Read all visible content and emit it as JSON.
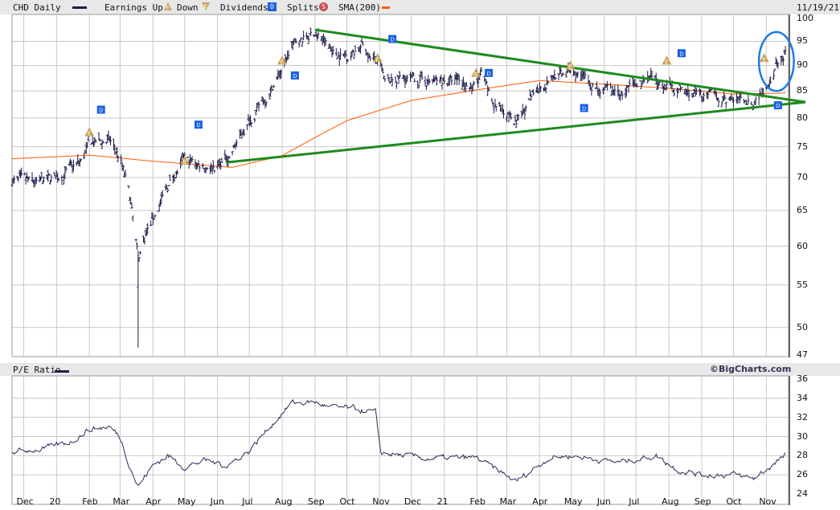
{
  "header": {
    "symbol_label": "CHD Daily",
    "earnings_label": "Earnings Up",
    "down_label": "Down",
    "dividends_label": "Dividends",
    "splits_label": "Splits",
    "sma_label": "SMA(200)",
    "date": "11/19/21",
    "earnings_up_glyph": "E",
    "earnings_down_glyph": "E",
    "dividend_glyph": "D",
    "split_glyph": "S"
  },
  "lower_header": {
    "label": "P/E Ratio",
    "brand": "©BigCharts.com"
  },
  "colors": {
    "price": "#1c1c4c",
    "sma": "#ff5a00",
    "trend": "#1e8a1e",
    "highlight": "#1a7be6",
    "earnings": "#c8a050",
    "dividend": "#1a5fe0",
    "split": "#c85050",
    "grid": "#c8c8c8"
  },
  "chart_data": [
    {
      "type": "line",
      "title": "CHD Daily",
      "ylabel": "Price",
      "y_scale": "log",
      "ylim": [
        47,
        100
      ],
      "yticks": [
        "100",
        "95",
        "90",
        "85",
        "80",
        "75",
        "70",
        "65",
        "60",
        "55",
        "50",
        "47"
      ],
      "x_range": [
        "2019-11-20",
        "2021-11-22"
      ],
      "x_ticks": [
        {
          "label": "Dec",
          "date": "2019-12-01"
        },
        {
          "label": "20",
          "date": "2020-01-01"
        },
        {
          "label": "Feb",
          "date": "2020-02-01"
        },
        {
          "label": "Mar",
          "date": "2020-03-01"
        },
        {
          "label": "Apr",
          "date": "2020-04-01"
        },
        {
          "label": "May",
          "date": "2020-05-01"
        },
        {
          "label": "Jun",
          "date": "2020-06-01"
        },
        {
          "label": "Jul",
          "date": "2020-07-01"
        },
        {
          "label": "Aug",
          "date": "2020-08-01"
        },
        {
          "label": "Sep",
          "date": "2020-09-01"
        },
        {
          "label": "Oct",
          "date": "2020-10-01"
        },
        {
          "label": "Nov",
          "date": "2020-11-01"
        },
        {
          "label": "Dec",
          "date": "2020-12-01"
        },
        {
          "label": "21",
          "date": "2021-01-01"
        },
        {
          "label": "Feb",
          "date": "2021-02-01"
        },
        {
          "label": "Mar",
          "date": "2021-03-01"
        },
        {
          "label": "Apr",
          "date": "2021-04-01"
        },
        {
          "label": "May",
          "date": "2021-05-01"
        },
        {
          "label": "Jun",
          "date": "2021-06-01"
        },
        {
          "label": "Jul",
          "date": "2021-07-01"
        },
        {
          "label": "Aug",
          "date": "2021-08-01"
        },
        {
          "label": "Sep",
          "date": "2021-09-01"
        },
        {
          "label": "Oct",
          "date": "2021-10-01"
        },
        {
          "label": "Nov",
          "date": "2021-11-01"
        }
      ],
      "price_close_approx": [
        [
          "2019-11-20",
          69.5
        ],
        [
          "2019-12-15",
          69.0
        ],
        [
          "2020-01-01",
          70.0
        ],
        [
          "2020-01-25",
          72.5
        ],
        [
          "2020-02-01",
          75.5
        ],
        [
          "2020-02-20",
          76.0
        ],
        [
          "2020-03-01",
          73.0
        ],
        [
          "2020-03-10",
          67.0
        ],
        [
          "2020-03-18",
          58.0
        ],
        [
          "2020-03-25",
          61.5
        ],
        [
          "2020-04-05",
          65.0
        ],
        [
          "2020-04-18",
          69.5
        ],
        [
          "2020-05-01",
          72.7
        ],
        [
          "2020-05-15",
          72.0
        ],
        [
          "2020-06-01",
          71.8
        ],
        [
          "2020-06-12",
          73.5
        ],
        [
          "2020-07-01",
          79.5
        ],
        [
          "2020-07-20",
          84.7
        ],
        [
          "2020-08-01",
          89.4
        ],
        [
          "2020-08-12",
          94.5
        ],
        [
          "2020-09-01",
          96.8
        ],
        [
          "2020-09-20",
          92.5
        ],
        [
          "2020-10-01",
          92.0
        ],
        [
          "2020-10-15",
          94.0
        ],
        [
          "2020-11-01",
          90.0
        ],
        [
          "2020-11-06",
          86.0
        ],
        [
          "2020-11-20",
          87.5
        ],
        [
          "2020-12-15",
          86.8
        ],
        [
          "2021-01-15",
          87.0
        ],
        [
          "2021-01-31",
          85.5
        ],
        [
          "2021-02-05",
          88.0
        ],
        [
          "2021-02-15",
          82.5
        ],
        [
          "2021-03-01",
          81.5
        ],
        [
          "2021-03-10",
          78.5
        ],
        [
          "2021-04-01",
          86.0
        ],
        [
          "2021-04-15",
          88.0
        ],
        [
          "2021-05-01",
          88.5
        ],
        [
          "2021-05-15",
          87.0
        ],
        [
          "2021-06-01",
          85.0
        ],
        [
          "2021-06-20",
          84.5
        ],
        [
          "2021-07-10",
          87.0
        ],
        [
          "2021-08-01",
          86.0
        ],
        [
          "2021-08-20",
          84.5
        ],
        [
          "2021-09-01",
          84.0
        ],
        [
          "2021-10-01",
          83.2
        ],
        [
          "2021-10-20",
          83.0
        ],
        [
          "2021-11-01",
          86.0
        ],
        [
          "2021-11-10",
          90.0
        ],
        [
          "2021-11-19",
          92.0
        ]
      ],
      "extreme_lows": [
        [
          "2020-03-18",
          47.8
        ]
      ],
      "sma200": [
        [
          "2019-11-20",
          73.0
        ],
        [
          "2020-02-01",
          73.6
        ],
        [
          "2020-04-01",
          72.6
        ],
        [
          "2020-06-15",
          71.6
        ],
        [
          "2020-08-01",
          73.5
        ],
        [
          "2020-10-01",
          79.5
        ],
        [
          "2020-12-01",
          83.2
        ],
        [
          "2021-02-01",
          85.2
        ],
        [
          "2021-04-01",
          87.0
        ],
        [
          "2021-06-01",
          86.3
        ],
        [
          "2021-08-01",
          85.5
        ],
        [
          "2021-10-01",
          84.4
        ],
        [
          "2021-11-19",
          84.6
        ]
      ],
      "earnings_markers": [
        [
          "2020-02-01",
          77.5
        ],
        [
          "2020-05-01",
          72.7
        ],
        [
          "2020-08-01",
          91.0
        ],
        [
          "2020-10-30",
          91.5
        ],
        [
          "2021-01-31",
          88.5
        ],
        [
          "2021-04-30",
          90.0
        ],
        [
          "2021-07-30",
          91.0
        ],
        [
          "2021-10-30",
          91.5
        ]
      ],
      "dividend_markers": [
        [
          "2020-02-12",
          81.5
        ],
        [
          "2020-05-14",
          78.8
        ],
        [
          "2020-08-13",
          88.0
        ],
        [
          "2020-11-13",
          95.5
        ],
        [
          "2021-02-12",
          88.5
        ],
        [
          "2021-05-13",
          81.8
        ],
        [
          "2021-08-13",
          92.5
        ],
        [
          "2021-11-12",
          82.3
        ]
      ],
      "trendlines": [
        {
          "name": "upper",
          "from": [
            "2020-09-01",
            97.5
          ],
          "to": [
            "2021-12-08",
            82.9
          ]
        },
        {
          "name": "lower",
          "from": [
            "2020-06-09",
            72.4
          ],
          "to": [
            "2021-12-08",
            82.9
          ]
        }
      ],
      "highlight_ellipse": {
        "from": "2021-10-25",
        "to": "2021-11-27",
        "low": 85.0,
        "high": 97.0
      }
    },
    {
      "type": "line",
      "title": "P/E Ratio",
      "ylim": [
        24,
        36
      ],
      "yticks": [
        "36",
        "34",
        "32",
        "30",
        "28",
        "26",
        "24"
      ],
      "values_approx": [
        [
          "2019-11-20",
          28.4
        ],
        [
          "2019-12-20",
          28.7
        ],
        [
          "2020-01-15",
          29.5
        ],
        [
          "2020-02-01",
          30.8
        ],
        [
          "2020-02-20",
          31.0
        ],
        [
          "2020-03-01",
          30.0
        ],
        [
          "2020-03-10",
          27.0
        ],
        [
          "2020-03-18",
          24.8
        ],
        [
          "2020-04-01",
          27.0
        ],
        [
          "2020-04-15",
          28.0
        ],
        [
          "2020-05-01",
          26.8
        ],
        [
          "2020-05-20",
          27.5
        ],
        [
          "2020-06-10",
          27.0
        ],
        [
          "2020-07-01",
          28.5
        ],
        [
          "2020-07-20",
          31.0
        ],
        [
          "2020-08-10",
          33.5
        ],
        [
          "2020-09-01",
          33.6
        ],
        [
          "2020-09-15",
          33.0
        ],
        [
          "2020-10-01",
          33.0
        ],
        [
          "2020-10-28",
          32.5
        ],
        [
          "2020-11-02",
          28.3
        ],
        [
          "2020-12-15",
          27.7
        ],
        [
          "2021-01-31",
          27.8
        ],
        [
          "2021-02-15",
          26.8
        ],
        [
          "2021-03-10",
          25.3
        ],
        [
          "2021-04-10",
          27.8
        ],
        [
          "2021-05-01",
          28.0
        ],
        [
          "2021-06-15",
          27.3
        ],
        [
          "2021-07-20",
          28.0
        ],
        [
          "2021-08-10",
          26.5
        ],
        [
          "2021-09-01",
          26.0
        ],
        [
          "2021-10-01",
          26.0
        ],
        [
          "2021-10-20",
          25.6
        ],
        [
          "2021-11-19",
          28.0
        ]
      ]
    }
  ]
}
